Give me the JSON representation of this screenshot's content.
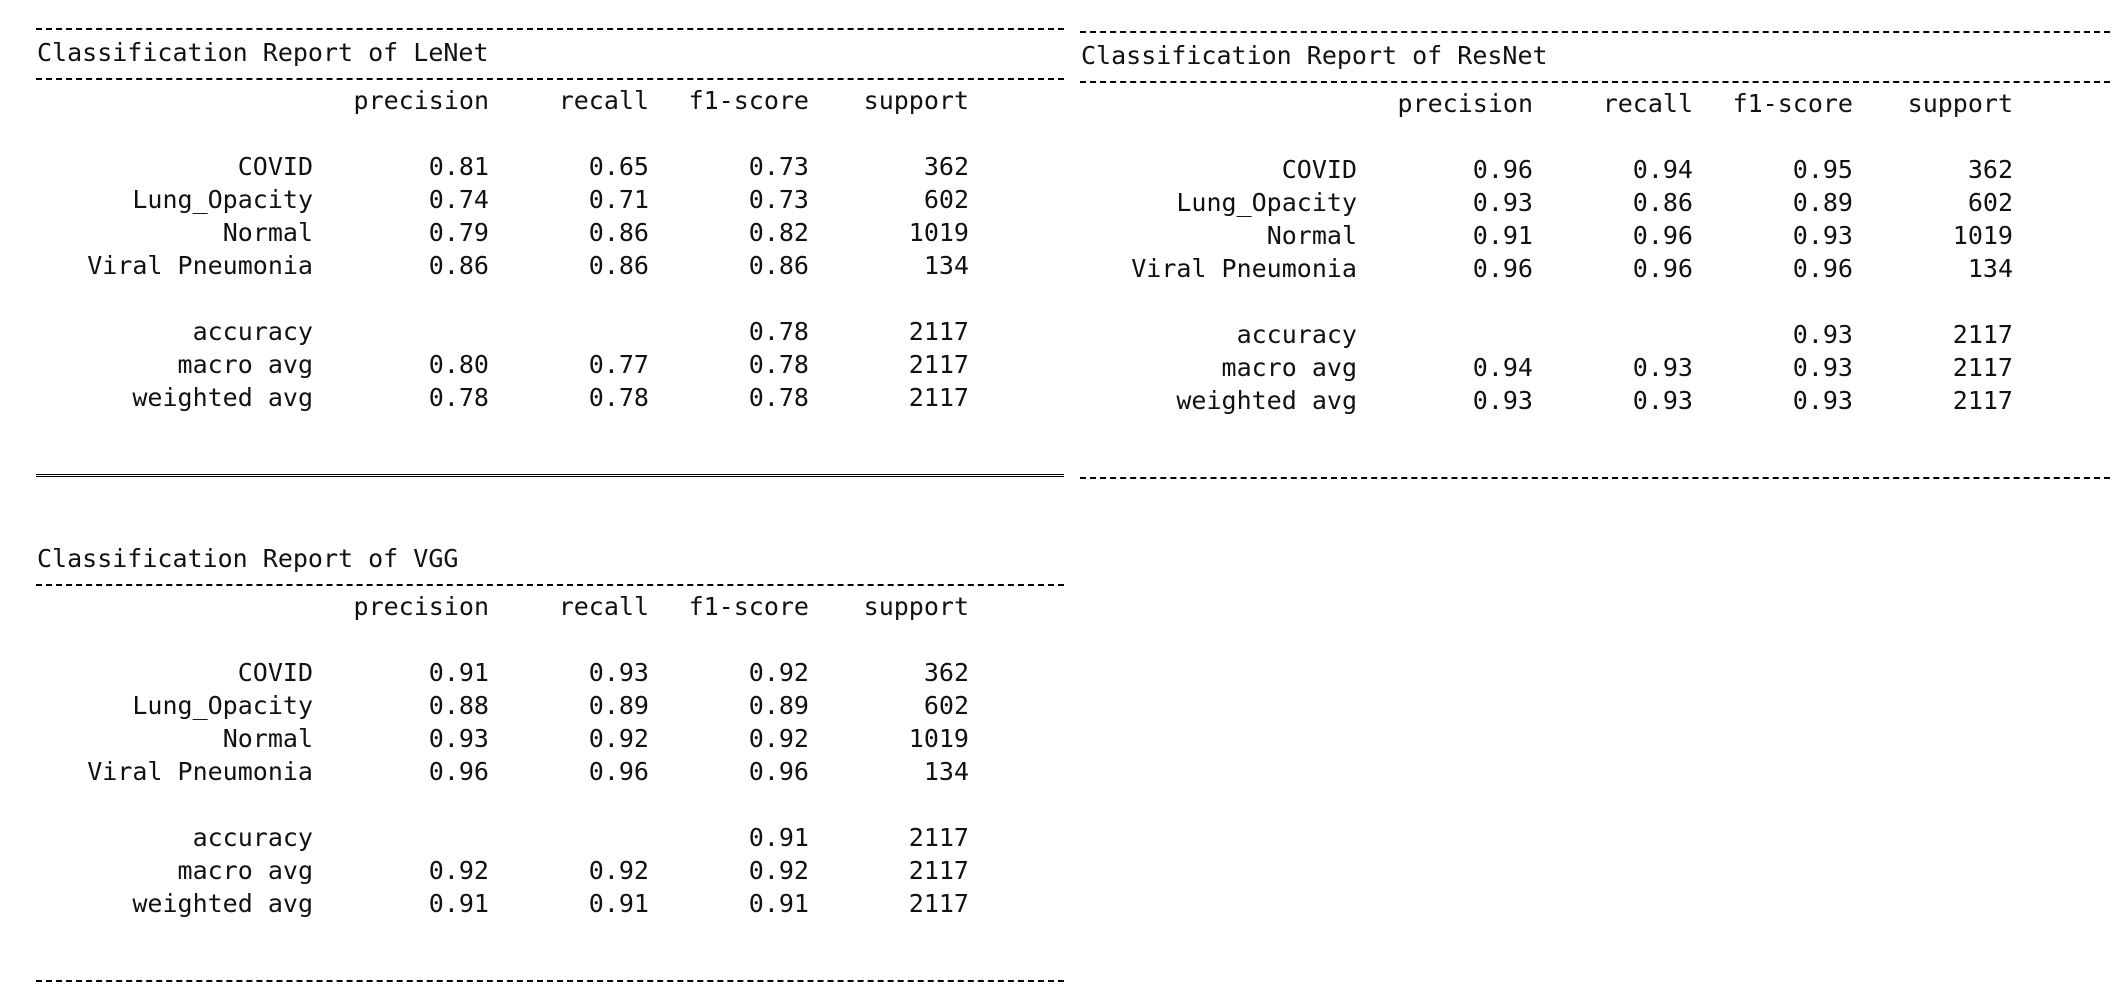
{
  "header": [
    "precision",
    "recall",
    "f1-score",
    "support"
  ],
  "reports": [
    {
      "title": "Classification Report of LeNet",
      "rows": [
        [
          "COVID",
          "0.81",
          "0.65",
          "0.73",
          "362"
        ],
        [
          "Lung_Opacity",
          "0.74",
          "0.71",
          "0.73",
          "602"
        ],
        [
          "Normal",
          "0.79",
          "0.86",
          "0.82",
          "1019"
        ],
        [
          "Viral Pneumonia",
          "0.86",
          "0.86",
          "0.86",
          "134"
        ]
      ],
      "summary": [
        [
          "accuracy",
          "",
          "",
          "0.78",
          "2117"
        ],
        [
          "macro avg",
          "0.80",
          "0.77",
          "0.78",
          "2117"
        ],
        [
          "weighted avg",
          "0.78",
          "0.78",
          "0.78",
          "2117"
        ]
      ]
    },
    {
      "title": "Classification Report of ResNet",
      "rows": [
        [
          "COVID",
          "0.96",
          "0.94",
          "0.95",
          "362"
        ],
        [
          "Lung_Opacity",
          "0.93",
          "0.86",
          "0.89",
          "602"
        ],
        [
          "Normal",
          "0.91",
          "0.96",
          "0.93",
          "1019"
        ],
        [
          "Viral Pneumonia",
          "0.96",
          "0.96",
          "0.96",
          "134"
        ]
      ],
      "summary": [
        [
          "accuracy",
          "",
          "",
          "0.93",
          "2117"
        ],
        [
          "macro avg",
          "0.94",
          "0.93",
          "0.93",
          "2117"
        ],
        [
          "weighted avg",
          "0.93",
          "0.93",
          "0.93",
          "2117"
        ]
      ]
    },
    {
      "title": "Classification Report of VGG",
      "rows": [
        [
          "COVID",
          "0.91",
          "0.93",
          "0.92",
          "362"
        ],
        [
          "Lung_Opacity",
          "0.88",
          "0.89",
          "0.89",
          "602"
        ],
        [
          "Normal",
          "0.93",
          "0.92",
          "0.92",
          "1019"
        ],
        [
          "Viral Pneumonia",
          "0.96",
          "0.96",
          "0.96",
          "134"
        ]
      ],
      "summary": [
        [
          "accuracy",
          "",
          "",
          "0.91",
          "2117"
        ],
        [
          "macro avg",
          "0.92",
          "0.92",
          "0.92",
          "2117"
        ],
        [
          "weighted avg",
          "0.91",
          "0.91",
          "0.91",
          "2117"
        ]
      ]
    }
  ]
}
